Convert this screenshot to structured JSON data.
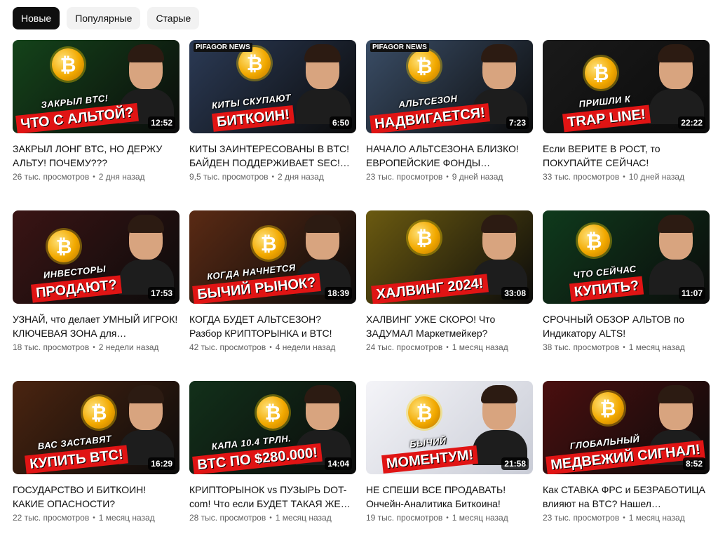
{
  "filters": {
    "chips": [
      {
        "label": "Новые",
        "active": true
      },
      {
        "label": "Популярные",
        "active": false
      },
      {
        "label": "Старые",
        "active": false
      }
    ]
  },
  "videos": [
    {
      "title": "ЗАКРЫЛ ЛОНГ BTC, НО ДЕРЖУ АЛЬТУ! ПОЧЕМУ???",
      "views": "26 тыс. просмотров",
      "age": "2 дня назад",
      "duration": "12:52",
      "thumb_top": "ЗАКРЫЛ BTC!",
      "thumb_main": "ЧТО С АЛЬТОЙ?",
      "bg": "#14431a",
      "brand": ""
    },
    {
      "title": "КИТЫ ЗАИНТЕРЕСОВАНЫ В BTC! БАЙДЕН ПОДДЕРЖИВАЕТ SEC!…",
      "views": "9,5 тыс. просмотров",
      "age": "2 дня назад",
      "duration": "6:50",
      "thumb_top": "КИТЫ СКУПАЮТ",
      "thumb_main": "БИТКОИН!",
      "bg": "#2b3a55",
      "brand": "PIFAGOR NEWS"
    },
    {
      "title": "НАЧАЛО АЛЬТСЕЗОНА БЛИЗКО! ЕВРОПЕЙСКИЕ ФОНДЫ…",
      "views": "23 тыс. просмотров",
      "age": "9 дней назад",
      "duration": "7:23",
      "thumb_top": "АЛЬТСЕЗОН",
      "thumb_main": "НАДВИГАЕТСЯ!",
      "bg": "#3a4d66",
      "brand": "PIFAGOR NEWS"
    },
    {
      "title": "Если ВЕРИТЕ В РОСТ, то ПОКУПАЙТЕ СЕЙЧАС!",
      "views": "33 тыс. просмотров",
      "age": "10 дней назад",
      "duration": "22:22",
      "thumb_top": "ПРИШЛИ К",
      "thumb_main": "TRAP LINE!",
      "bg": "#1a1a1a",
      "brand": ""
    },
    {
      "title": "УЗНАЙ, что делает УМНЫЙ ИГРОК! КЛЮЧЕВАЯ ЗОНА для…",
      "views": "18 тыс. просмотров",
      "age": "2 недели назад",
      "duration": "17:53",
      "thumb_top": "ИНВЕСТОРЫ",
      "thumb_main": "ПРОДАЮТ?",
      "bg": "#3a1414",
      "brand": ""
    },
    {
      "title": "КОГДА БУДЕТ АЛЬТСЕЗОН? Разбор КРИПТОРЫНКА и BTC!",
      "views": "42 тыс. просмотров",
      "age": "4 недели назад",
      "duration": "18:39",
      "thumb_top": "КОГДА НАЧНЕТСЯ",
      "thumb_main": "БЫЧИЙ РЫНОК?",
      "bg": "#5a2a14",
      "brand": ""
    },
    {
      "title": "ХАЛВИНГ УЖЕ СКОРО! Что ЗАДУМАЛ Маркетмейкер?",
      "views": "24 тыс. просмотров",
      "age": "1 месяц назад",
      "duration": "33:08",
      "thumb_top": "",
      "thumb_main": "ХАЛВИНГ 2024!",
      "bg": "#6b5a10",
      "brand": ""
    },
    {
      "title": "СРОЧНЫЙ ОБЗОР АЛЬТОВ по Индикатору ALTS!",
      "views": "38 тыс. просмотров",
      "age": "1 месяц назад",
      "duration": "11:07",
      "thumb_top": "ЧТО СЕЙЧАС",
      "thumb_main": "КУПИТЬ?",
      "bg": "#0f3a1c",
      "brand": ""
    },
    {
      "title": "ГОСУДАРСТВО И БИТКОИН! КАКИЕ ОПАСНОСТИ?",
      "views": "22 тыс. просмотров",
      "age": "1 месяц назад",
      "duration": "16:29",
      "thumb_top": "ВАС ЗАСТАВЯТ",
      "thumb_main": "КУПИТЬ BTC!",
      "bg": "#4a2410",
      "brand": ""
    },
    {
      "title": "КРИПТОРЫНОК vs ПУЗЫРЬ DOT-com! Что если БУДЕТ ТАКАЯ ЖЕ…",
      "views": "28 тыс. просмотров",
      "age": "1 месяц назад",
      "duration": "14:04",
      "thumb_top": "КАПА 10.4 ТРЛН.",
      "thumb_main": "BTC ПО $280.000!",
      "bg": "#12301a",
      "brand": ""
    },
    {
      "title": "НЕ СПЕШИ ВСЕ ПРОДАВАТЬ! Ончейн-Аналитика Биткоина!",
      "views": "19 тыс. просмотров",
      "age": "1 месяц назад",
      "duration": "21:58",
      "thumb_top": "БЫЧИЙ",
      "thumb_main": "МОМЕНТУМ!",
      "bg": "#e9e9ee",
      "brand": ""
    },
    {
      "title": "Как СТАВКА ФРС и БЕЗРАБОТИЦА влияют на BTC? Нашел…",
      "views": "23 тыс. просмотров",
      "age": "1 месяц назад",
      "duration": "8:52",
      "thumb_top": "ГЛОБАЛЬНЫЙ",
      "thumb_main": "МЕДВЕЖИЙ СИГНАЛ!",
      "bg": "#4a0f0f",
      "brand": ""
    }
  ],
  "icons": {
    "bitcoin": "bitcoin-coin-icon"
  }
}
